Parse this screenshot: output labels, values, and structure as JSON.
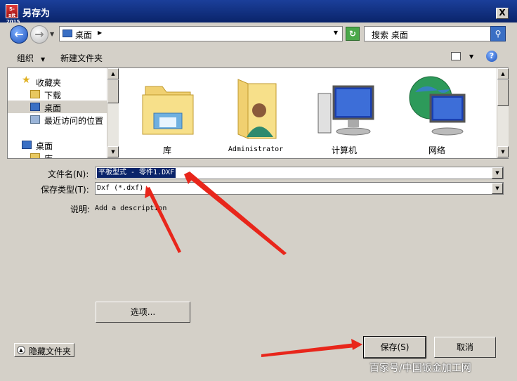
{
  "window": {
    "title": "另存为",
    "app_badge": "S-sit 2015",
    "close_label": "X"
  },
  "nav": {
    "address": "桌面",
    "search_placeholder": "搜索 桌面"
  },
  "toolbar": {
    "organize": "组织",
    "new_folder": "新建文件夹"
  },
  "nav_pane": {
    "items": [
      {
        "label": "收藏夹",
        "icon": "star-icon"
      },
      {
        "label": "下载",
        "icon": "download-folder-icon"
      },
      {
        "label": "桌面",
        "icon": "desktop-icon",
        "selected": true
      },
      {
        "label": "最近访问的位置",
        "icon": "recent-places-icon"
      },
      {
        "label": "桌面",
        "icon": "desktop-icon"
      },
      {
        "label": "库",
        "icon": "library-icon"
      }
    ]
  },
  "items": [
    {
      "label": "库",
      "icon": "library-folder-icon"
    },
    {
      "label": "Administrator",
      "icon": "user-folder-icon"
    },
    {
      "label": "计算机",
      "icon": "computer-icon"
    },
    {
      "label": "网络",
      "icon": "network-globe-icon"
    }
  ],
  "form": {
    "filename_label": "文件名(N):",
    "filename_value": "平板型式 - 零件1.DXF",
    "filetype_label": "保存类型(T):",
    "filetype_value": "Dxf (*.dxf)",
    "desc_label": "说明:",
    "desc_value": "Add a description",
    "options_button": "选项...",
    "hide_folders_button": "隐藏文件夹",
    "save_button": "保存(S)",
    "cancel_button": "取消"
  },
  "watermark": "百家号/中国钣金加工网",
  "colors": {
    "titlebar": "#0a246a",
    "face": "#d4d0c8",
    "annotation_arrow": "#e8261b"
  }
}
